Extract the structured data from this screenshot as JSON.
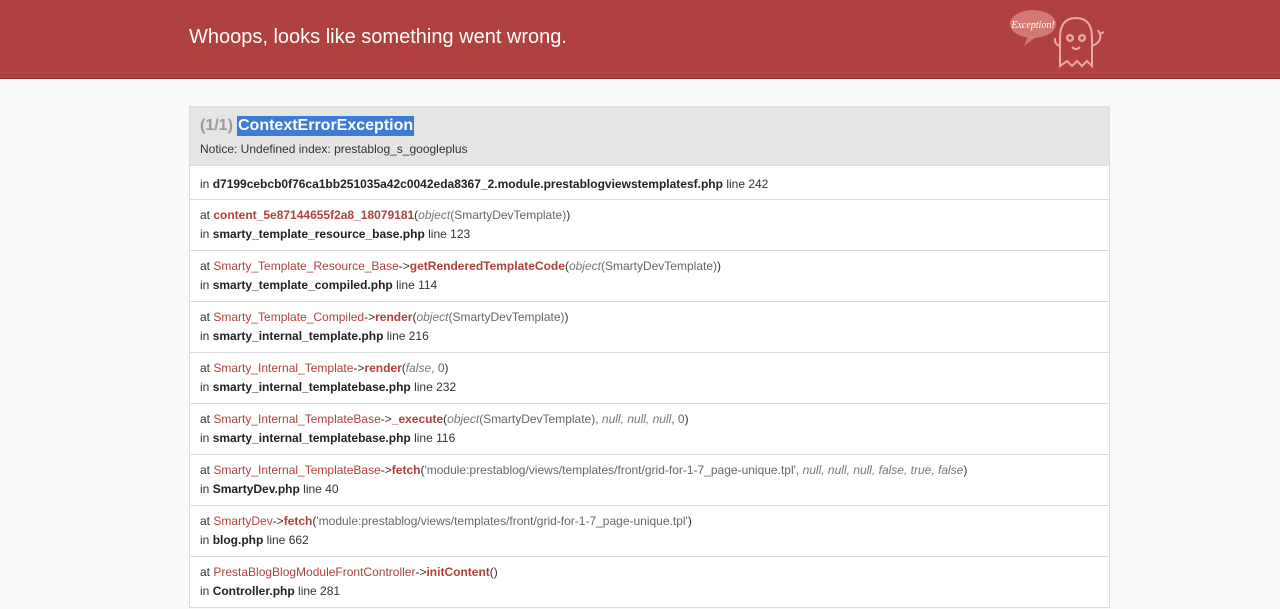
{
  "header": {
    "title": "Whoops, looks like something went wrong.",
    "logo_text": "Exception!"
  },
  "exception": {
    "count": "(1/1)",
    "class_name": "ContextErrorException",
    "message": "Notice: Undefined index: prestablog_s_googleplus",
    "file_prefix": "in",
    "file": "d7199cebcb0f76ca1bb251035a42c0042eda8367_2.module.prestablogviewstemplatesf.php",
    "line": "line 242"
  },
  "frames": [
    {
      "at": "at",
      "class": "",
      "arrow": "",
      "method": "content_5e87144655f2a8_18079181",
      "args_open": "(",
      "args": [
        {
          "type": "object",
          "value": "(SmartyDevTemplate)"
        }
      ],
      "args_close": ")",
      "in": "in",
      "file": "smarty_template_resource_base.php",
      "line": "line 123"
    },
    {
      "at": "at",
      "class": "Smarty_Template_Resource_Base",
      "arrow": "->",
      "method": "getRenderedTemplateCode",
      "args_open": "(",
      "args": [
        {
          "type": "object",
          "value": "(SmartyDevTemplate)"
        }
      ],
      "args_close": ")",
      "in": "in",
      "file": "smarty_template_compiled.php",
      "line": "line 114"
    },
    {
      "at": "at",
      "class": "Smarty_Template_Compiled",
      "arrow": "->",
      "method": "render",
      "args_open": "(",
      "args": [
        {
          "type": "object",
          "value": "(SmartyDevTemplate)"
        }
      ],
      "args_close": ")",
      "in": "in",
      "file": "smarty_internal_template.php",
      "line": "line 216"
    },
    {
      "at": "at",
      "class": "Smarty_Internal_Template",
      "arrow": "->",
      "method": "render",
      "args_open": "(",
      "args": [
        {
          "type": "false",
          "value": ", 0"
        }
      ],
      "args_close": ")",
      "in": "in",
      "file": "smarty_internal_templatebase.php",
      "line": "line 232"
    },
    {
      "at": "at",
      "class": "Smarty_Internal_TemplateBase",
      "arrow": "->",
      "method": "_execute",
      "args_open": "(",
      "args": [
        {
          "type": "object",
          "value": "(SmartyDevTemplate), "
        },
        {
          "type": "null, null, null",
          "value": ", 0"
        }
      ],
      "args_close": ")",
      "in": "in",
      "file": "smarty_internal_templatebase.php",
      "line": "line 116"
    },
    {
      "at": "at",
      "class": "Smarty_Internal_TemplateBase",
      "arrow": "->",
      "method": "fetch",
      "args_open": "(",
      "args": [
        {
          "type": "",
          "value": "'module:prestablog/views/templates/front/grid-for-1-7_page-unique.tpl', "
        },
        {
          "type": "null, null, null, false, true, false",
          "value": ""
        }
      ],
      "args_close": ")",
      "in": "in",
      "file": "SmartyDev.php",
      "line": "line 40"
    },
    {
      "at": "at",
      "class": "SmartyDev",
      "arrow": "->",
      "method": "fetch",
      "args_open": "(",
      "args": [
        {
          "type": "",
          "value": "'module:prestablog/views/templates/front/grid-for-1-7_page-unique.tpl'"
        }
      ],
      "args_close": ")",
      "in": "in",
      "file": "blog.php",
      "line": "line 662"
    },
    {
      "at": "at",
      "class": "PrestaBlogBlogModuleFrontController",
      "arrow": "->",
      "method": "initContent",
      "args_open": "(",
      "args": [],
      "args_close": ")",
      "in": "in",
      "file": "Controller.php",
      "line": "line 281"
    }
  ],
  "colors": {
    "header_bg": "#b0413e",
    "accent": "#b0413e",
    "selection": "#3d7cd6",
    "page_bg": "#f9f9f9"
  }
}
